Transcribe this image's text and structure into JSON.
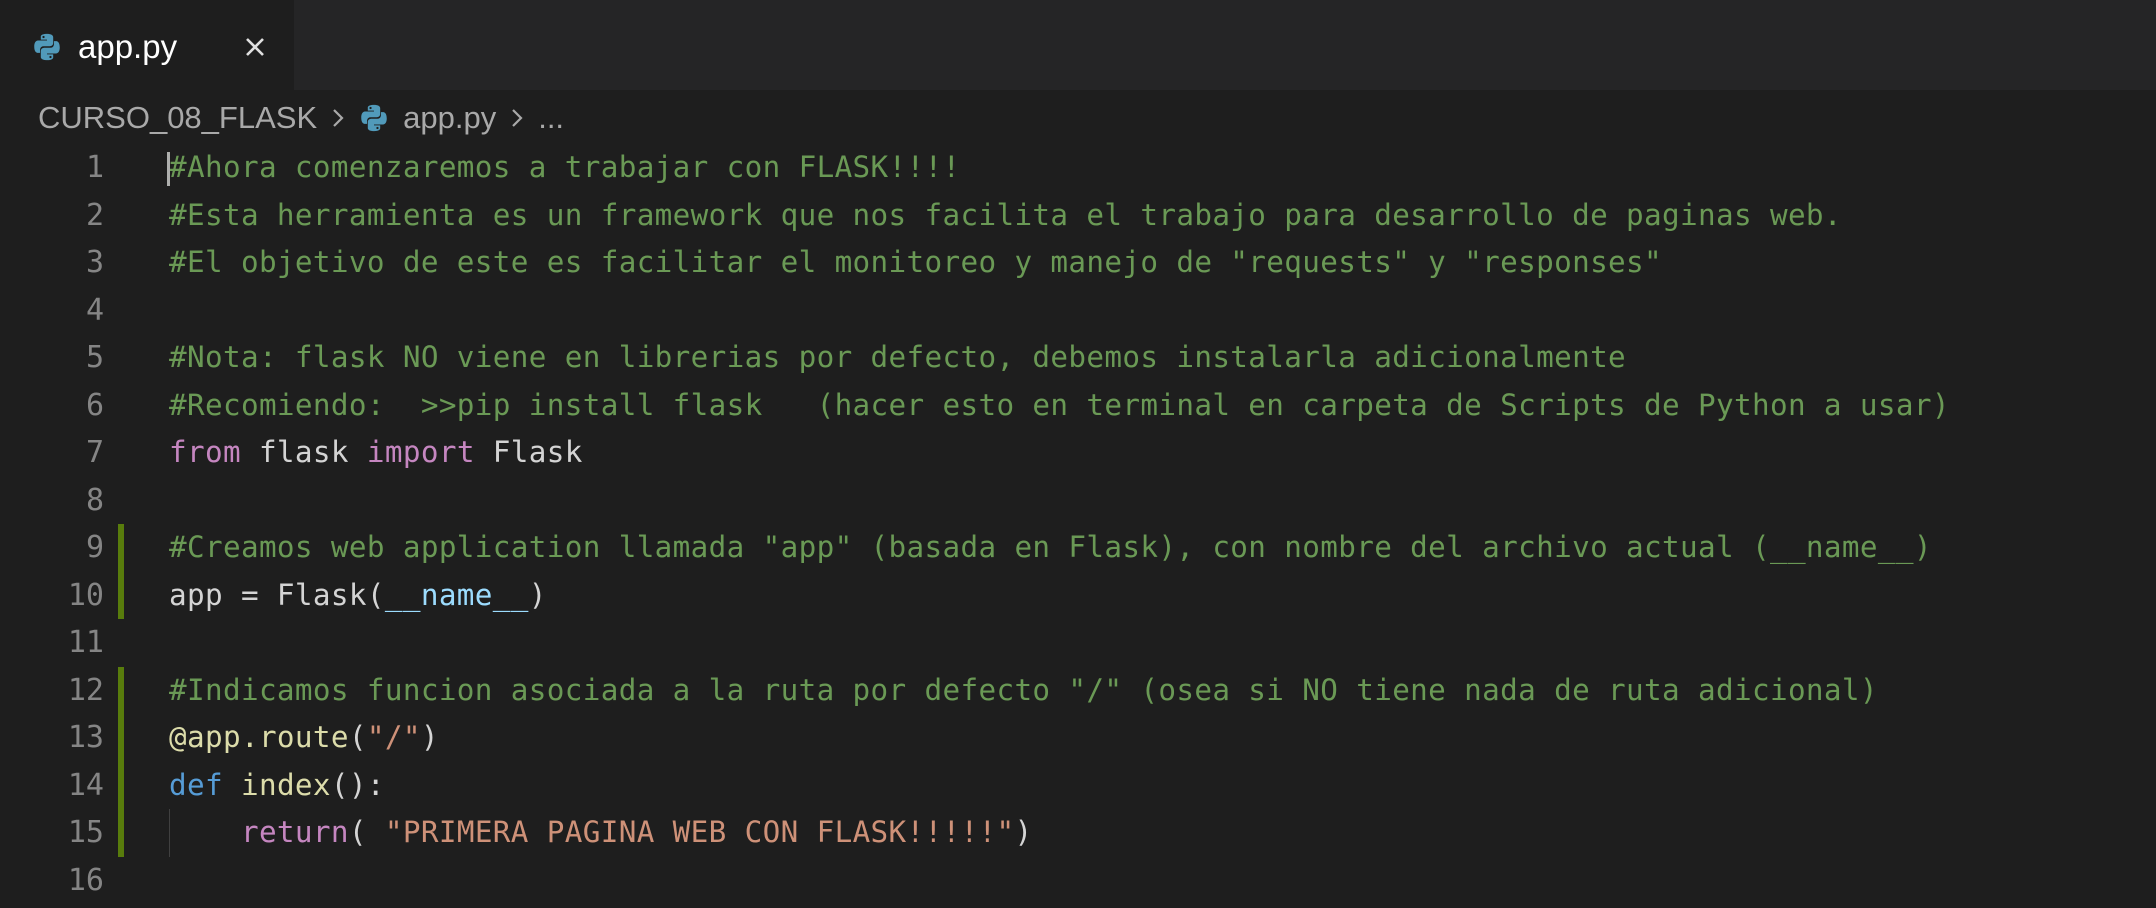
{
  "tabs": [
    {
      "label": "app.py",
      "icon": "python-icon",
      "active": true
    }
  ],
  "breadcrumb": {
    "folder": "CURSO_08_FLASK",
    "file": "app.py",
    "more": "..."
  },
  "colors": {
    "editor_bg": "#1e1e1e",
    "tabbar_bg": "#252526",
    "comment": "#6a9955",
    "keyword": "#c586c0",
    "def_keyword": "#569cd6",
    "function": "#dcdcaa",
    "string": "#ce9178",
    "variable": "#9cdcfe",
    "line_number": "#858585",
    "modified_gutter": "#587c0c",
    "python_icon": "#519aba"
  },
  "editor": {
    "lines": [
      {
        "number": "1",
        "tokens": [
          {
            "type": "comment",
            "text": "#Ahora comenzaremos a trabajar con FLASK!!!!"
          }
        ]
      },
      {
        "number": "2",
        "tokens": [
          {
            "type": "comment",
            "text": "#Esta herramienta es un framework que nos facilita el trabajo para desarrollo de paginas web."
          }
        ]
      },
      {
        "number": "3",
        "tokens": [
          {
            "type": "comment",
            "text": "#El objetivo de este es facilitar el monitoreo y manejo de \"requests\" y \"responses\""
          }
        ]
      },
      {
        "number": "4",
        "tokens": []
      },
      {
        "number": "5",
        "tokens": [
          {
            "type": "comment",
            "text": "#Nota: flask NO viene en librerias por defecto, debemos instalarla adicionalmente"
          }
        ]
      },
      {
        "number": "6",
        "tokens": [
          {
            "type": "comment",
            "text": "#Recomiendo:  >>pip install flask   (hacer esto en terminal en carpeta de Scripts de Python a usar)"
          }
        ]
      },
      {
        "number": "7",
        "tokens": [
          {
            "type": "keyword",
            "text": "from"
          },
          {
            "type": "plain",
            "text": " flask "
          },
          {
            "type": "keyword",
            "text": "import"
          },
          {
            "type": "plain",
            "text": " Flask"
          }
        ]
      },
      {
        "number": "8",
        "tokens": []
      },
      {
        "number": "9",
        "modified": true,
        "tokens": [
          {
            "type": "comment",
            "text": "#Creamos web application llamada \"app\" (basada en Flask), con nombre del archivo actual (__name__)"
          }
        ]
      },
      {
        "number": "10",
        "modified": true,
        "tokens": [
          {
            "type": "plain",
            "text": "app = Flask("
          },
          {
            "type": "var",
            "text": "__name__"
          },
          {
            "type": "plain",
            "text": ")"
          }
        ]
      },
      {
        "number": "11",
        "tokens": []
      },
      {
        "number": "12",
        "modified": true,
        "tokens": [
          {
            "type": "comment",
            "text": "#Indicamos funcion asociada a la ruta por defecto \"/\" (osea si NO tiene nada de ruta adicional)"
          }
        ]
      },
      {
        "number": "13",
        "modified": true,
        "tokens": [
          {
            "type": "func",
            "text": "@app.route"
          },
          {
            "type": "plain",
            "text": "("
          },
          {
            "type": "string",
            "text": "\"/\""
          },
          {
            "type": "plain",
            "text": ")"
          }
        ]
      },
      {
        "number": "14",
        "modified": true,
        "tokens": [
          {
            "type": "def",
            "text": "def"
          },
          {
            "type": "plain",
            "text": " "
          },
          {
            "type": "func",
            "text": "index"
          },
          {
            "type": "plain",
            "text": "():"
          }
        ]
      },
      {
        "number": "15",
        "modified": true,
        "tokens": [
          {
            "type": "plain",
            "text": "    "
          },
          {
            "type": "keyword",
            "text": "return"
          },
          {
            "type": "plain",
            "text": "( "
          },
          {
            "type": "string",
            "text": "\"PRIMERA PAGINA WEB CON FLASK!!!!!\""
          },
          {
            "type": "plain",
            "text": ")"
          }
        ]
      },
      {
        "number": "16",
        "tokens": []
      }
    ]
  }
}
